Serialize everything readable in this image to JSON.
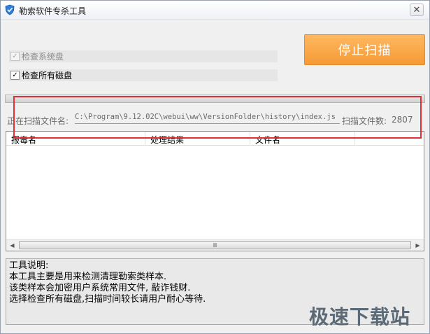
{
  "window": {
    "title": "勒索软件专杀工具",
    "close_glyph": "✕"
  },
  "options": {
    "check_system_disk": {
      "label": "检查系统盘",
      "checked": true,
      "enabled": false
    },
    "check_all_disks": {
      "label": "检查所有磁盘",
      "checked": true,
      "enabled": true
    }
  },
  "stop_button": {
    "label": "停止扫描",
    "color": "#f7a442"
  },
  "progress": {
    "value": 0.0
  },
  "scan": {
    "label": "正在扫描文件名:",
    "current_path": "C:\\Program\\9.12.02C\\webui\\ww\\VersionFolder\\history\\index.js",
    "count_label": "扫描文件数:",
    "count_value": "2807"
  },
  "list": {
    "columns": [
      "报毒名",
      "处理结果",
      "文件名"
    ],
    "rows": [],
    "scroll_grip": "Ⅲ"
  },
  "description": {
    "lines": [
      "工具说明:",
      "本工具主要是用来检测清理勒索类样本.",
      "该类样本会加密用户系统常用文件, 敲诈钱财.",
      "选择检查所有磁盘,扫描时间较长请用户耐心等待."
    ]
  },
  "watermark": "极速下载站",
  "annotation_color": "#e0313a"
}
